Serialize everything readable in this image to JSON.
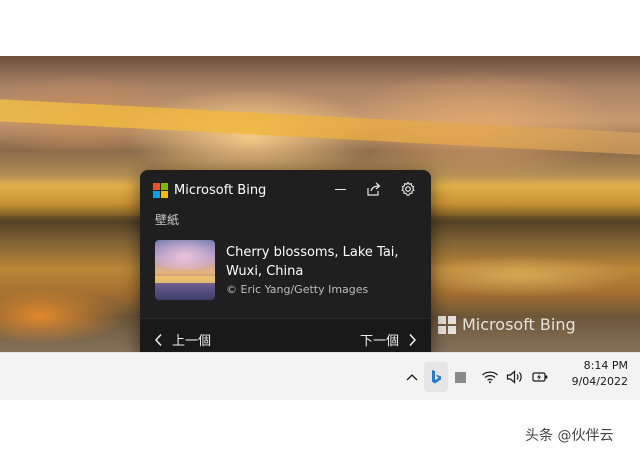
{
  "wallpaper": {
    "watermark_text": "Microsoft Bing"
  },
  "popup": {
    "app_title": "Microsoft Bing",
    "section_label": "壁紙",
    "image_title": "Cherry blossoms, Lake Tai, Wuxi, China",
    "credit": "© Eric Yang/Getty Images",
    "prev_label": "上一個",
    "next_label": "下一個",
    "icons": [
      "microsoft-logo-icon",
      "minimize-icon",
      "share-icon",
      "gear-icon",
      "chevron-left-icon",
      "chevron-right-icon"
    ]
  },
  "taskbar": {
    "time": "8:14 PM",
    "date": "9/04/2022",
    "tray_icons": [
      "chevron-up-icon",
      "bing-icon",
      "tray-app-icon",
      "wifi-icon",
      "volume-icon",
      "battery-icon"
    ]
  },
  "colors": {
    "ms_red": "#f25022",
    "ms_green": "#7fba00",
    "ms_blue": "#00a4ef",
    "ms_yellow": "#ffb900",
    "bing_blue": "#1e7bd6",
    "popup_bg": "#1f1f1f"
  },
  "source_watermark": "头条 @伙伴云"
}
